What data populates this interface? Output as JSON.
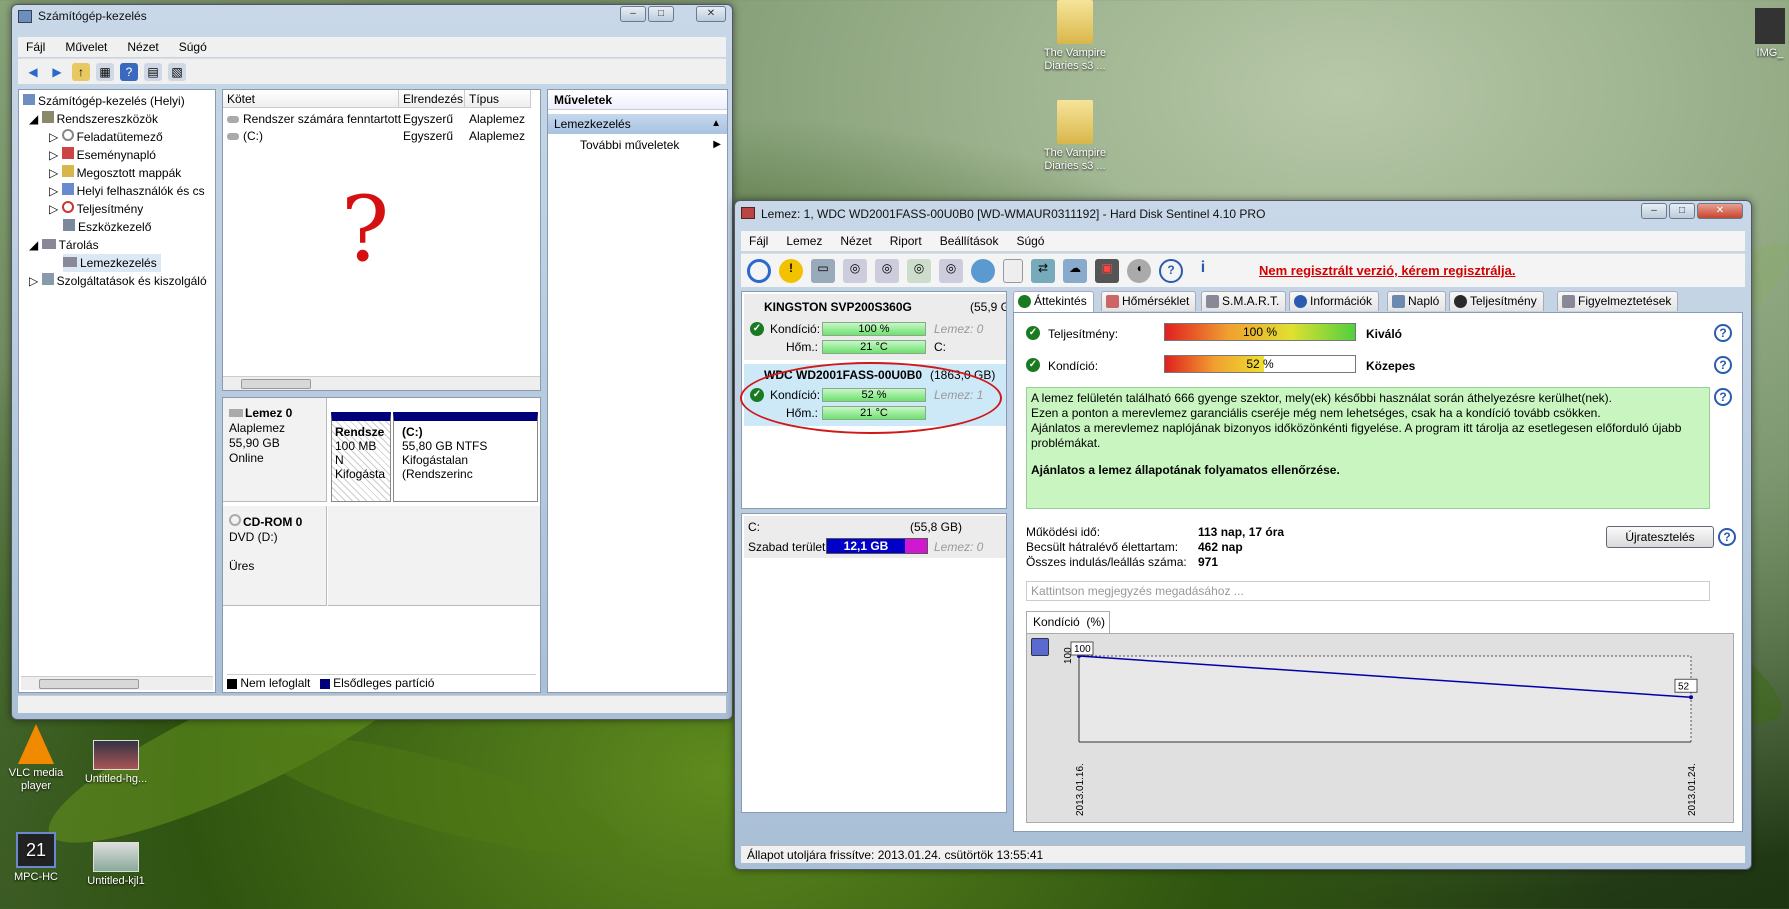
{
  "desktop": {
    "icons": [
      {
        "label": "The Vampire Diaries s3 ...",
        "kind": "folder"
      },
      {
        "label": "The Vampire Diaries s3 ...",
        "kind": "folder"
      },
      {
        "label": "VLC media player",
        "kind": "vlc"
      },
      {
        "label": "Untitled-hg...",
        "kind": "image"
      },
      {
        "label": "MPC-HC",
        "kind": "mpc"
      },
      {
        "label": "Untitled-kjl1",
        "kind": "image"
      },
      {
        "label": "IMG_",
        "kind": "image"
      }
    ]
  },
  "cm": {
    "title": "Számítógép-kezelés",
    "menu": [
      "Fájl",
      "Művelet",
      "Nézet",
      "Súgó"
    ],
    "tree": [
      "Számítógép-kezelés (Helyi)",
      "Rendszereszközök",
      "Feladatütemező",
      "Eseménynapló",
      "Megosztott mappák",
      "Helyi felhasználók és cs",
      "Teljesítmény",
      "Eszközkezelő",
      "Tárolás",
      "Lemezkezelés",
      "Szolgáltatások és kiszolgáló"
    ],
    "vol_headers": [
      "Kötet",
      "Elrendezés",
      "Típus"
    ],
    "volumes": [
      [
        "Rendszer számára fenntartott",
        "Egyszerű",
        "Alaplemez"
      ],
      [
        "(C:)",
        "Egyszerű",
        "Alaplemez"
      ]
    ],
    "annotation": "?",
    "disk0": {
      "name": "Lemez 0",
      "type": "Alaplemez",
      "size": "55,90 GB",
      "status": "Online",
      "p1": {
        "name": "Rendsze",
        "size": "100 MB N",
        "status": "Kifogásta"
      },
      "p2": {
        "name": "(C:)",
        "size": "55,80 GB NTFS",
        "status": "Kifogástalan (Rendszerinc"
      }
    },
    "cdrom": {
      "name": "CD-ROM 0",
      "type": "DVD (D:)",
      "status": "Üres"
    },
    "legend": [
      "Nem lefoglalt",
      "Elsődleges partíció"
    ],
    "actions": {
      "header": "Műveletek",
      "section": "Lemezkezelés",
      "more": "További műveletek"
    }
  },
  "hds": {
    "title": "Lemez: 1, WDC WD2001FASS-00U0B0 [WD-WMAUR0311192]  -  Hard Disk Sentinel 4.10 PRO",
    "menu": [
      "Fájl",
      "Lemez",
      "Nézet",
      "Riport",
      "Beállítások",
      "Súgó"
    ],
    "unreg": "Nem regisztrált verzió, kérem regisztrálja.",
    "disks": [
      {
        "name": "KINGSTON SVP200S360G",
        "size": "(55,9 G",
        "cond_label": "Kondíció:",
        "cond": "100 %",
        "cond_pct": 100,
        "lemez": "Lemez: 0",
        "temp_label": "Hőm.:",
        "temp": "21 °C",
        "drv": "C:"
      },
      {
        "name": "WDC WD2001FASS-00U0B0",
        "size": "(1863,0 GB)",
        "cond_label": "Kondíció:",
        "cond": "52 %",
        "cond_pct": 52,
        "lemez": "Lemez: 1",
        "temp_label": "Hőm.:",
        "temp": "21 °C"
      }
    ],
    "vol": {
      "drv": "C:",
      "size": "(55,8 GB)",
      "free_label": "Szabad terület",
      "free": "12,1 GB",
      "lemez": "Lemez: 0"
    },
    "tabs": [
      "Áttekintés",
      "Hőmérséklet",
      "S.M.A.R.T.",
      "Információk",
      "Napló",
      "Teljesítmény",
      "Figyelmeztetések"
    ],
    "perf": {
      "label": "Teljesítmény:",
      "value": "100 %",
      "pct": 100,
      "rating": "Kiváló"
    },
    "cond": {
      "label": "Kondíció:",
      "value": "52 %",
      "pct": 52,
      "rating": "Közepes"
    },
    "msg": [
      "A lemez felületén található 666 gyenge szektor, mely(ek) későbbi használat során áthelyezésre kerülhet(nek).",
      "Ezen a ponton a merevlemez garanciális cseréje még nem lehetséges, csak ha a kondíció tovább csökken.",
      "Ajánlatos a merevlemez naplójának bizonyos időközönkénti figyelése. A program itt tárolja az esetlegesen előforduló újabb problémákat.",
      "Ajánlatos a lemez állapotának folyamatos ellenőrzése."
    ],
    "stats": [
      [
        "Működési idő:",
        "113 nap, 17 óra"
      ],
      [
        "Becsült hátralévő élettartam:",
        "462 nap"
      ],
      [
        "Összes indulás/leállás száma:",
        "971"
      ]
    ],
    "retest": "Újratesztelés",
    "note": "Kattintson megjegyzés megadásához ...",
    "chart_tab": "Kondíció  (%)",
    "status": "Állapot utoljára frissítve: 2013.01.24. csütörtök 13:55:41"
  },
  "chart_data": {
    "type": "line",
    "x": [
      "2013.01.16.",
      "2013.01.24."
    ],
    "series": [
      {
        "values": [
          100,
          52
        ]
      }
    ],
    "ylim": [
      0,
      100
    ],
    "ytick": "100",
    "labels": [
      "100",
      "52"
    ],
    "grid": false,
    "color": "#0000aa"
  }
}
